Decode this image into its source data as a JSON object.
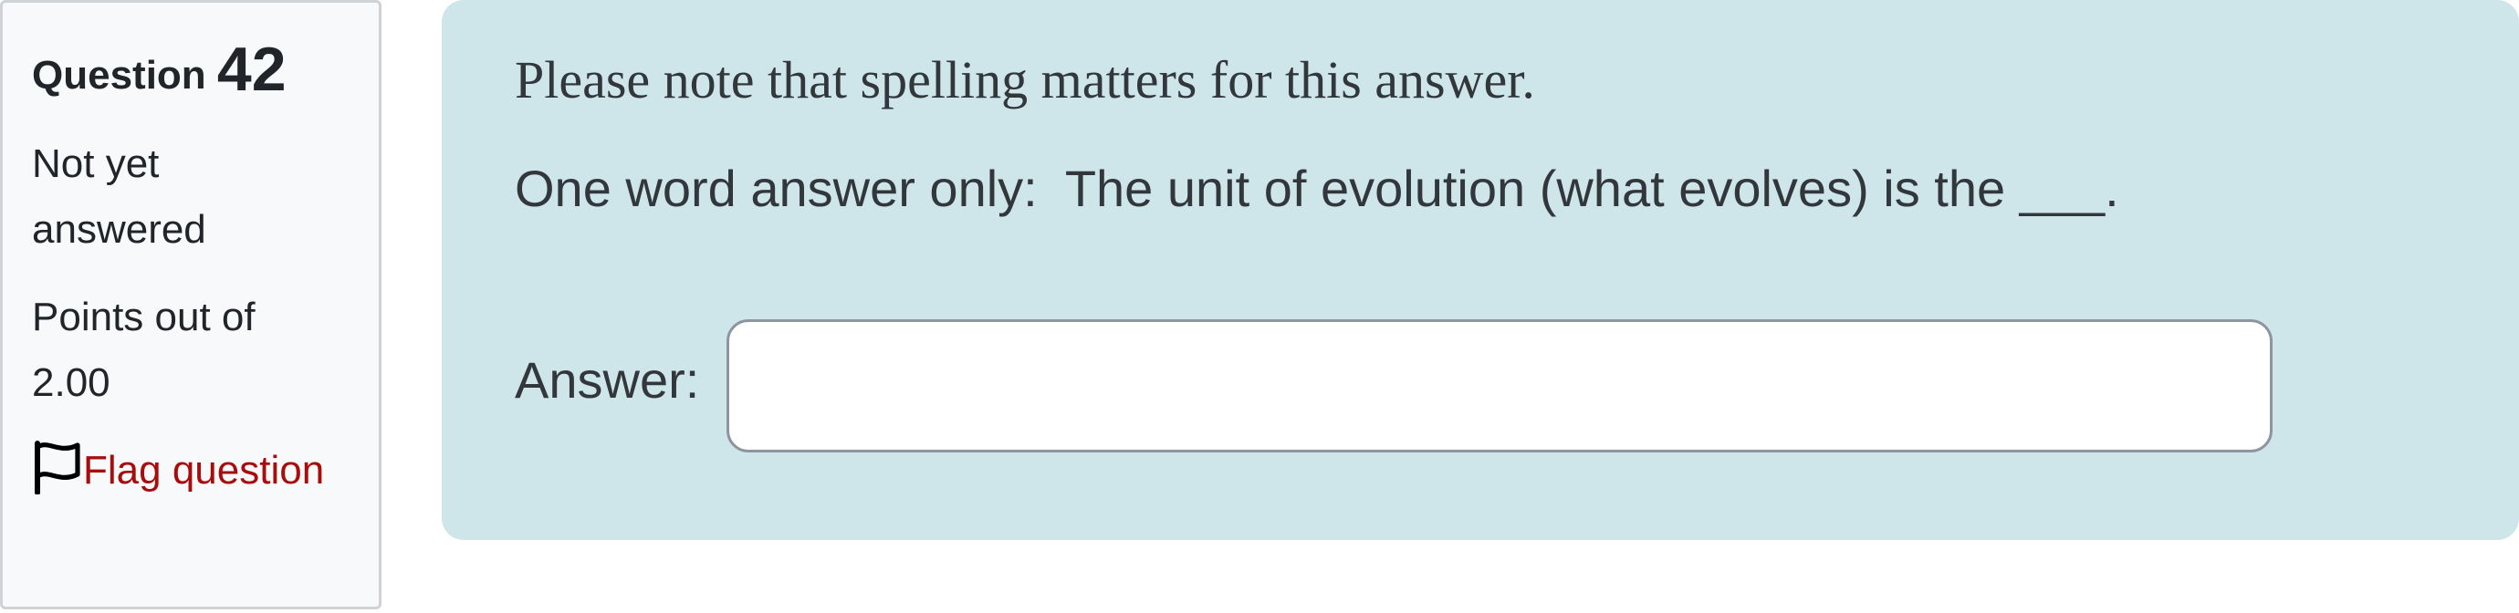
{
  "info": {
    "question_label": "Question",
    "question_number": "42",
    "state": "Not yet answered",
    "grade": "Points out of 2.00",
    "flag_label": "Flag question"
  },
  "content": {
    "note": "Please note that spelling matters for this answer.",
    "question_text": "One word answer only:  The unit of evolution (what evolves) is the ___.",
    "answer_label": "Answer:",
    "answer_value": ""
  },
  "colors": {
    "info_background": "#f8f9fa",
    "content_background": "#cee6ea",
    "flag_link": "#a80d0d"
  },
  "icons": {
    "flag": "flag-outline-icon"
  }
}
